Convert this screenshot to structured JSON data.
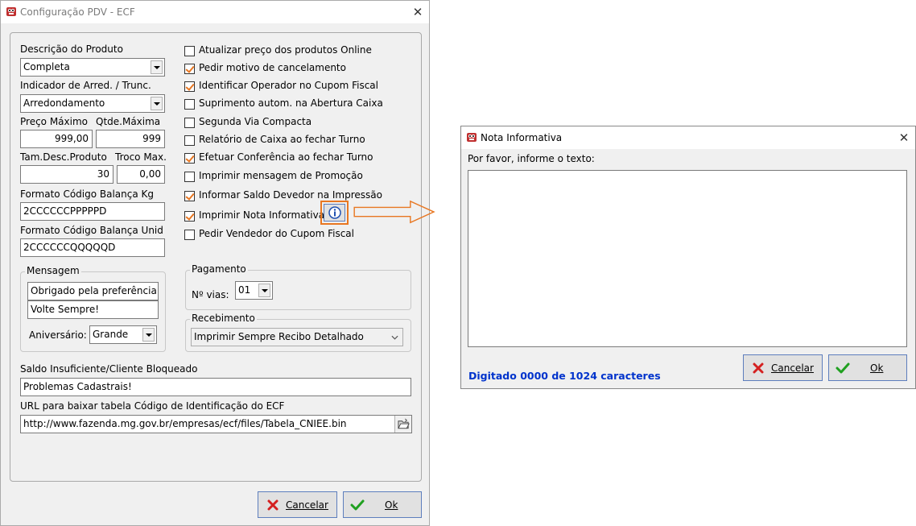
{
  "main_window": {
    "title": "Configuração PDV - ECF",
    "close_glyph": "✕",
    "descricao_produto": {
      "label": "Descrição do Produto",
      "value": "Completa"
    },
    "indicador": {
      "label": "Indicador de Arred. / Trunc.",
      "value": "Arredondamento"
    },
    "preco_maximo": {
      "label": "Preço Máximo",
      "value": "999,00"
    },
    "qtde_maxima": {
      "label": "Qtde.Máxima",
      "value": "999"
    },
    "tam_desc": {
      "label": "Tam.Desc.Produto",
      "value": "30"
    },
    "troco_max": {
      "label": "Troco Max.",
      "value": "0,00"
    },
    "formato_kg": {
      "label": "Formato Código Balança Kg",
      "value": "2CCCCCCPPPPPD"
    },
    "formato_unid": {
      "label": "Formato Código Balança Unid",
      "value": "2CCCCCCQQQQQD"
    },
    "checkboxes": [
      {
        "label": "Atualizar preço dos produtos Online",
        "checked": false
      },
      {
        "label": "Pedir motivo de cancelamento",
        "checked": true
      },
      {
        "label": "Identificar Operador no Cupom Fiscal",
        "checked": true
      },
      {
        "label": "Suprimento autom. na Abertura Caixa",
        "checked": false
      },
      {
        "label": "Segunda Via Compacta",
        "checked": false
      },
      {
        "label": "Relatório de Caixa ao fechar Turno",
        "checked": false
      },
      {
        "label": "Efetuar Conferência ao fechar Turno",
        "checked": true
      },
      {
        "label": "Imprimir mensagem de Promoção",
        "checked": false
      },
      {
        "label": "Informar Saldo Devedor na Impressão",
        "checked": true
      },
      {
        "label": "Imprimir Nota Informativa",
        "checked": true
      },
      {
        "label": "Pedir Vendedor do Cupom Fiscal",
        "checked": false
      }
    ],
    "mensagem": {
      "title": "Mensagem",
      "line1": "Obrigado pela preferência!",
      "line2": "Volte Sempre!",
      "aniversario_label": "Aniversário:",
      "aniversario_value": "Grande"
    },
    "pagamento": {
      "title": "Pagamento",
      "vias_label": "Nº vias:",
      "vias_value": "01"
    },
    "recebimento": {
      "title": "Recebimento",
      "value": "Imprimir Sempre Recibo Detalhado"
    },
    "saldo": {
      "label": "Saldo Insuficiente/Cliente Bloqueado",
      "value": "Problemas Cadastrais!"
    },
    "url": {
      "label": "URL para baixar tabela Código de Identificação do ECF",
      "value": "http://www.fazenda.mg.gov.br/empresas/ecf/files/Tabela_CNIEE.bin"
    },
    "cancel_label": "Cancelar",
    "ok_label": "Ok"
  },
  "nota_window": {
    "title": "Nota Informativa",
    "close_glyph": "✕",
    "prompt": "Por favor, informe o texto:",
    "text_value": "",
    "counter": "Digitado 0000 de 1024 caracteres",
    "cancel_label": "Cancelar",
    "ok_label": "Ok"
  },
  "colors": {
    "accent": "#e87722",
    "counter_blue": "#0033cc",
    "button_border": "#5d7ebd"
  },
  "icons": {
    "app": "app-logo-icon",
    "info": "info-icon",
    "folder": "open-folder-icon",
    "cancel": "red-x-icon",
    "ok": "green-check-icon",
    "arrow": "orange-arrow-icon"
  }
}
